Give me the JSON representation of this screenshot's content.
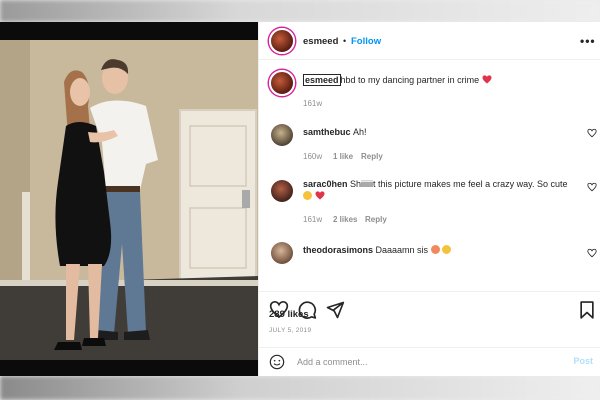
{
  "post": {
    "username": "esmeed",
    "separator": "•",
    "follow_label": "Follow",
    "more_label": "•••",
    "caption": {
      "username": "esmeed",
      "text": "hbd to my dancing partner in crime",
      "time": "161w"
    },
    "comments": [
      {
        "username": "samthebuc",
        "text": "Ah!",
        "time": "160w",
        "likes": "1 like",
        "reply": "Reply"
      },
      {
        "username": "sarac0hen",
        "text": "Shiiiiiit this picture makes me feel a crazy way. So cute",
        "time": "161w",
        "likes": "2 likes",
        "reply": "Reply"
      },
      {
        "username": "theodorasimons",
        "text": "Daaaamn sis"
      }
    ],
    "likes_count": "289 likes",
    "date": "JULY 5, 2019",
    "add_comment_placeholder": "Add a comment...",
    "post_label": "Post"
  },
  "icons": {
    "heart": "heart-icon",
    "comment": "comment-icon",
    "share": "paper-plane-icon",
    "save": "bookmark-icon",
    "emoji": "smiley-icon"
  },
  "colors": {
    "accent": "#0095f6",
    "heart_red": "#ed4956",
    "muted": "#8e8e8e",
    "post_disabled": "#b2dffc"
  }
}
